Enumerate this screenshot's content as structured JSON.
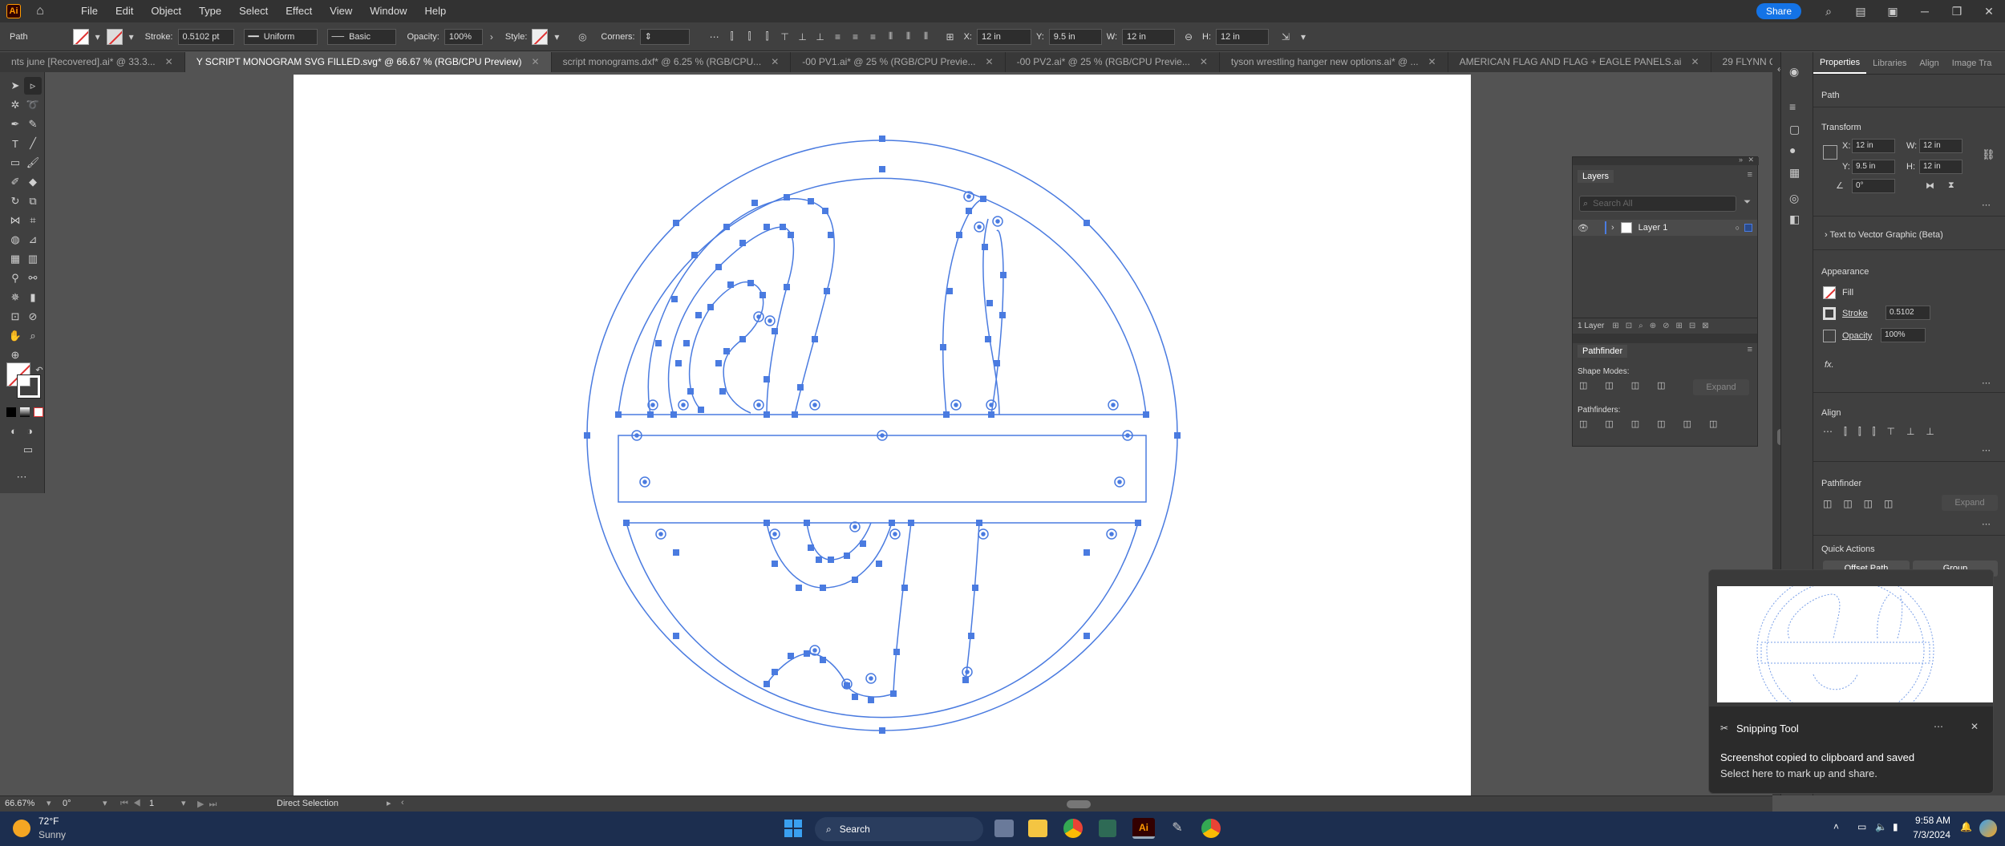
{
  "app": {
    "logo": "Ai",
    "menu": [
      "File",
      "Edit",
      "Object",
      "Type",
      "Select",
      "Effect",
      "View",
      "Window",
      "Help"
    ],
    "share_label": "Share"
  },
  "control_bar": {
    "object_type": "Path",
    "stroke_label": "Stroke:",
    "stroke_value": "0.5102 pt",
    "profile_value": "Uniform",
    "brush_value": "Basic",
    "opacity_label": "Opacity:",
    "opacity_value": "100%",
    "style_label": "Style:",
    "corners_label": "Corners:",
    "x_label": "X:",
    "x_value": "12 in",
    "y_label": "Y:",
    "y_value": "9.5 in",
    "w_label": "W:",
    "w_value": "12 in",
    "h_label": "H:",
    "h_value": "12 in"
  },
  "tabs": [
    {
      "label": "nts june [Recovered].ai* @ 33.3...",
      "active": false
    },
    {
      "label": "Y SCRIPT MONOGRAM SVG FILLED.svg* @ 66.67 % (RGB/CPU Preview)",
      "active": true
    },
    {
      "label": "script monograms.dxf* @ 6.25 % (RGB/CPU...",
      "active": false
    },
    {
      "label": "-00 PV1.ai* @ 25 % (RGB/CPU Previe...",
      "active": false
    },
    {
      "label": "-00 PV2.ai* @ 25 % (RGB/CPU Previe...",
      "active": false
    },
    {
      "label": "tyson wrestling hanger new options.ai* @ ...",
      "active": false
    },
    {
      "label": "AMERICAN FLAG AND FLAG + EAGLE PANELS.ai",
      "active": false
    },
    {
      "label": "29 FLYNN QUOTE.ai @ 16.67 % (RGB/CPU P...",
      "active": false
    }
  ],
  "colors": {
    "selection": "#4a7be0",
    "accent": "#1473e6"
  },
  "properties": {
    "tabs": [
      "Properties",
      "Libraries",
      "Align",
      "Image Tra"
    ],
    "object_type": "Path",
    "transform_title": "Transform",
    "x_label": "X:",
    "x_value": "12 in",
    "y_label": "Y:",
    "y_value": "9.5 in",
    "w_label": "W:",
    "w_value": "12 in",
    "h_label": "H:",
    "h_value": "12 in",
    "angle_value": "0°",
    "text_to_vector": "Text to Vector Graphic (Beta)",
    "appearance_title": "Appearance",
    "fill_label": "Fill",
    "stroke_label": "Stroke",
    "stroke_value": "0.5102",
    "opacity_label": "Opacity",
    "opacity_value": "100%",
    "fx_label": "fx.",
    "align_title": "Align",
    "pathfinder_title": "Pathfinder",
    "expand_label": "Expand",
    "quick_actions_title": "Quick Actions",
    "offset_path_label": "Offset Path",
    "group_label": "Group"
  },
  "layers_panel": {
    "title": "Layers",
    "search_placeholder": "Search All",
    "layer_name": "Layer 1",
    "footer_count": "1 Layer",
    "pathfinder_title": "Pathfinder",
    "shape_modes_label": "Shape Modes:",
    "pathfinders_label": "Pathfinders:",
    "expand_label": "Expand"
  },
  "status_bar": {
    "zoom": "66.67%",
    "angle": "0°",
    "artboard": "1",
    "tool": "Direct Selection"
  },
  "snipping": {
    "title": "Snipping Tool",
    "message": "Screenshot copied to clipboard and saved",
    "sub": "Select here to mark up and share."
  },
  "taskbar": {
    "temp": "72°F",
    "weather": "Sunny",
    "search_label": "Search",
    "time": "9:58 AM",
    "date": "7/3/2024"
  }
}
